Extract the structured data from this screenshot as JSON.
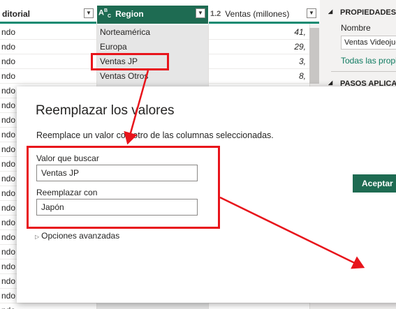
{
  "grid": {
    "columns": [
      {
        "type_icon": "",
        "label": "ditorial"
      },
      {
        "type_icon": "ABC",
        "label": "Region"
      },
      {
        "type_icon": "1.2",
        "label": "Ventas (millones)"
      }
    ],
    "rows": [
      {
        "c1": "ndo",
        "c2": "Norteamérica",
        "c3": "41,"
      },
      {
        "c1": "ndo",
        "c2": "Europa",
        "c3": "29,"
      },
      {
        "c1": "ndo",
        "c2": "Ventas JP",
        "c3": "3,"
      },
      {
        "c1": "ndo",
        "c2": "Ventas Otros",
        "c3": "8,"
      },
      {
        "c1": "ndo",
        "c2": "",
        "c3": ""
      },
      {
        "c1": "ndo",
        "c2": "",
        "c3": ""
      },
      {
        "c1": "ndo",
        "c2": "",
        "c3": ""
      },
      {
        "c1": "ndo",
        "c2": "",
        "c3": ""
      },
      {
        "c1": "ndo",
        "c2": "",
        "c3": ""
      },
      {
        "c1": "ndo",
        "c2": "",
        "c3": ""
      },
      {
        "c1": "ndo",
        "c2": "",
        "c3": ""
      },
      {
        "c1": "ndo",
        "c2": "",
        "c3": ""
      },
      {
        "c1": "ndo",
        "c2": "",
        "c3": ""
      },
      {
        "c1": "ndo",
        "c2": "",
        "c3": ""
      },
      {
        "c1": "ndo",
        "c2": "",
        "c3": ""
      },
      {
        "c1": "ndo",
        "c2": "",
        "c3": ""
      },
      {
        "c1": "ndo",
        "c2": "",
        "c3": ""
      },
      {
        "c1": "ndo",
        "c2": "",
        "c3": ""
      },
      {
        "c1": "ndo",
        "c2": "",
        "c3": ""
      },
      {
        "c1": "ndo",
        "c2": "",
        "c3": ""
      }
    ]
  },
  "pane": {
    "properties_title": "PROPIEDADES",
    "name_label": "Nombre",
    "name_value": "Ventas Videojuegos",
    "all_properties_link": "Todas las propiedades",
    "applied_steps_title": "PASOS APLICADOS"
  },
  "dialog": {
    "title": "Reemplazar los valores",
    "description": "Reemplace un valor con otro de las columnas seleccionadas.",
    "find_label": "Valor que buscar",
    "find_value": "Ventas JP",
    "replace_label": "Reemplazar con",
    "replace_value": "Japón",
    "advanced_label": "Opciones avanzadas",
    "ok_label": "Aceptar"
  },
  "annotation_color": "#e8141b"
}
